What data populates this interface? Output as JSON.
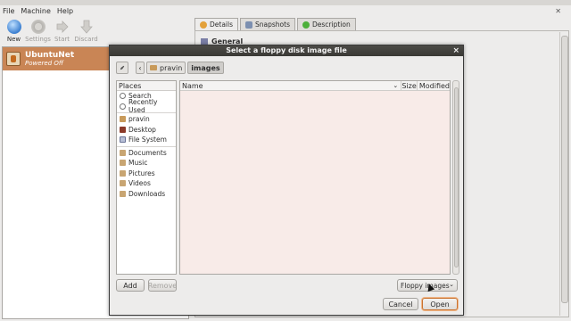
{
  "menu": [
    "File",
    "Machine",
    "Help"
  ],
  "toolbar": [
    {
      "label": "New",
      "icon": "new-icon",
      "enabled": true
    },
    {
      "label": "Settings",
      "icon": "gear-icon",
      "enabled": false
    },
    {
      "label": "Start",
      "icon": "start-arrow-icon",
      "enabled": false
    },
    {
      "label": "Discard",
      "icon": "discard-arrow-icon",
      "enabled": false
    }
  ],
  "vm": {
    "name": "UbuntuNet",
    "state": "Powered Off"
  },
  "tabs": [
    "Details",
    "Snapshots",
    "Description"
  ],
  "details": {
    "section": "General"
  },
  "dialog": {
    "title": "Select a floppy disk image file",
    "close": "×",
    "path": {
      "parent": "pravin",
      "current": "images"
    },
    "places_header": "Places",
    "places": [
      "Search",
      "Recently Used",
      "pravin",
      "Desktop",
      "File System",
      "Documents",
      "Music",
      "Pictures",
      "Videos",
      "Downloads"
    ],
    "columns": {
      "name": "Name",
      "size": "Size",
      "modified": "Modified"
    },
    "add": "Add",
    "remove": "Remove",
    "filter": "Floppy images",
    "cancel": "Cancel",
    "open": "Open"
  },
  "colors": {
    "selection": "#c98555",
    "file_pane": "#f8ebe8",
    "title_bar": "#3a3935"
  }
}
